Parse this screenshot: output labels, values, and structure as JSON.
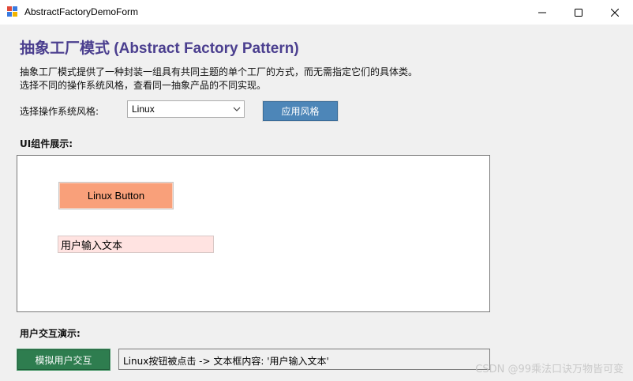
{
  "window": {
    "title": "AbstractFactoryDemoForm",
    "icon": "winforms-app-icon",
    "controls": [
      "minimize-icon",
      "maximize-icon",
      "close-icon"
    ]
  },
  "header": {
    "title": "抽象工厂模式 (Abstract Factory Pattern)",
    "desc_line1": "抽象工厂模式提供了一种封装一组具有共同主题的单个工厂的方式，而无需指定它们的具体类。",
    "desc_line2": "选择不同的操作系统风格，查看同一抽象产品的不同实现。"
  },
  "style_selector": {
    "label": "选择操作系统风格:",
    "selected": "Linux",
    "apply_label": "应用风格"
  },
  "ui_showcase": {
    "label": "UI组件展示:",
    "button_label": "Linux Button",
    "textbox_value": "用户输入文本"
  },
  "interaction": {
    "label": "用户交互演示:",
    "simulate_label": "模拟用户交互",
    "result_text": "Linux按钮被点击 -> 文本框内容: '用户输入文本'"
  },
  "watermark": "CSDN @99乘法口诀万物皆可变",
  "colors": {
    "heading": "#4b3f8f",
    "apply_button": "#4d86b8",
    "linux_button": "#f9a07a",
    "textbox_bg": "#ffe3e1",
    "simulate_button": "#2e7d4f"
  }
}
